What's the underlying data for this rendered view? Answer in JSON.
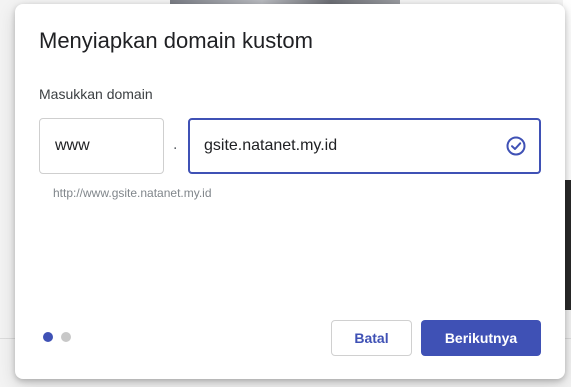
{
  "dialog": {
    "title": "Menyiapkan domain kustom",
    "field_label": "Masukkan domain",
    "subdomain_value": "www",
    "separator": ".",
    "domain_value": "gsite.natanet.my.id",
    "domain_valid_icon": "check-circle-icon",
    "helper_text": "http://www.gsite.natanet.my.id",
    "steps": {
      "total": 2,
      "current": 1
    },
    "cancel_label": "Batal",
    "next_label": "Berikutnya"
  },
  "colors": {
    "accent": "#3f51b5",
    "inactive_step": "#c8c8c8",
    "helper_text": "#80868b"
  }
}
